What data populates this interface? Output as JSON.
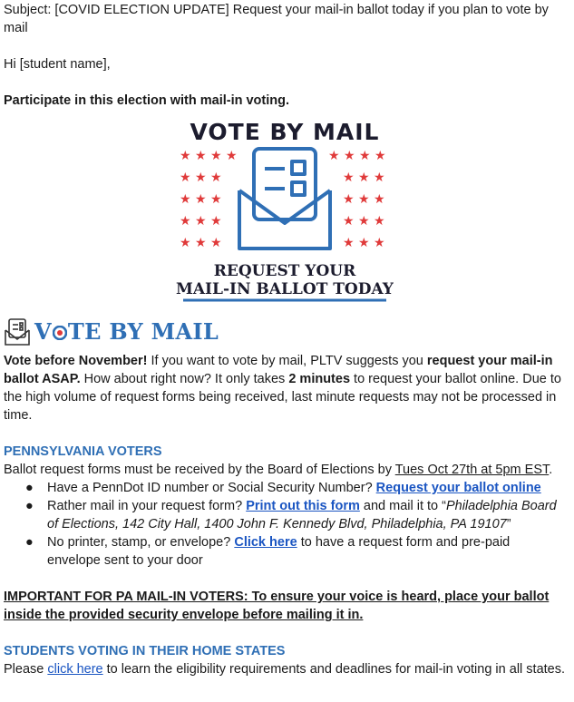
{
  "email": {
    "subject": "Subject: [COVID ELECTION UPDATE] Request your mail-in ballot today if you plan to vote by mail",
    "greeting": "Hi [student name],",
    "intro": "Participate in this election with mail-in voting."
  },
  "hero": {
    "title": "VOTE BY MAIL",
    "line1": "REQUEST YOUR",
    "line2": "MAIL-IN BALLOT TODAY",
    "colors": {
      "navy": "#1c1c2e",
      "red": "#e03a3a",
      "blue": "#2f6fb5"
    }
  },
  "logo": {
    "text": "VOTE BY MAIL",
    "icon": "mail-ballot-icon"
  },
  "para1": {
    "b1": "Vote before November!",
    "t1": " If you want to vote by mail, PLTV suggests you ",
    "b2": "request your mail-in ballot ASAP.",
    "t2": " How about right now? It only takes ",
    "b3": "2 minutes",
    "t3": " to request your ballot online. Due to the high volume of request forms being received, last minute requests may not be processed in time."
  },
  "pa": {
    "heading": "PENNSYLVANIA VOTERS",
    "line": "Ballot request forms must be received by the Board of Elections by ",
    "deadline": "Tues Oct 27th at 5pm EST",
    "period": ".",
    "bullets": [
      {
        "pre": "Have a PennDot ID number or Social Security Number? ",
        "link": "Request your ballot online",
        "post": ""
      },
      {
        "pre": "Rather mail in your request form? ",
        "link": "Print out this form",
        "post": " and mail it to “",
        "italic": "Philadelphia Board of Elections, 142 City Hall, 1400 John F. Kennedy Blvd, Philadelphia, PA 19107",
        "end": "”"
      },
      {
        "pre": "No printer, stamp, or envelope? ",
        "link": "Click here",
        "post": " to have a request form and pre-paid envelope sent to your door"
      }
    ]
  },
  "important": "IMPORTANT FOR PA MAIL-IN VOTERS: To ensure your voice is heard, place your ballot inside the provided security envelope before mailing it in.",
  "home": {
    "heading": "STUDENTS VOTING IN THEIR HOME STATES",
    "pre": "Please ",
    "link": "click here",
    "post": " to learn the eligibility requirements and deadlines for mail-in voting in all states."
  }
}
